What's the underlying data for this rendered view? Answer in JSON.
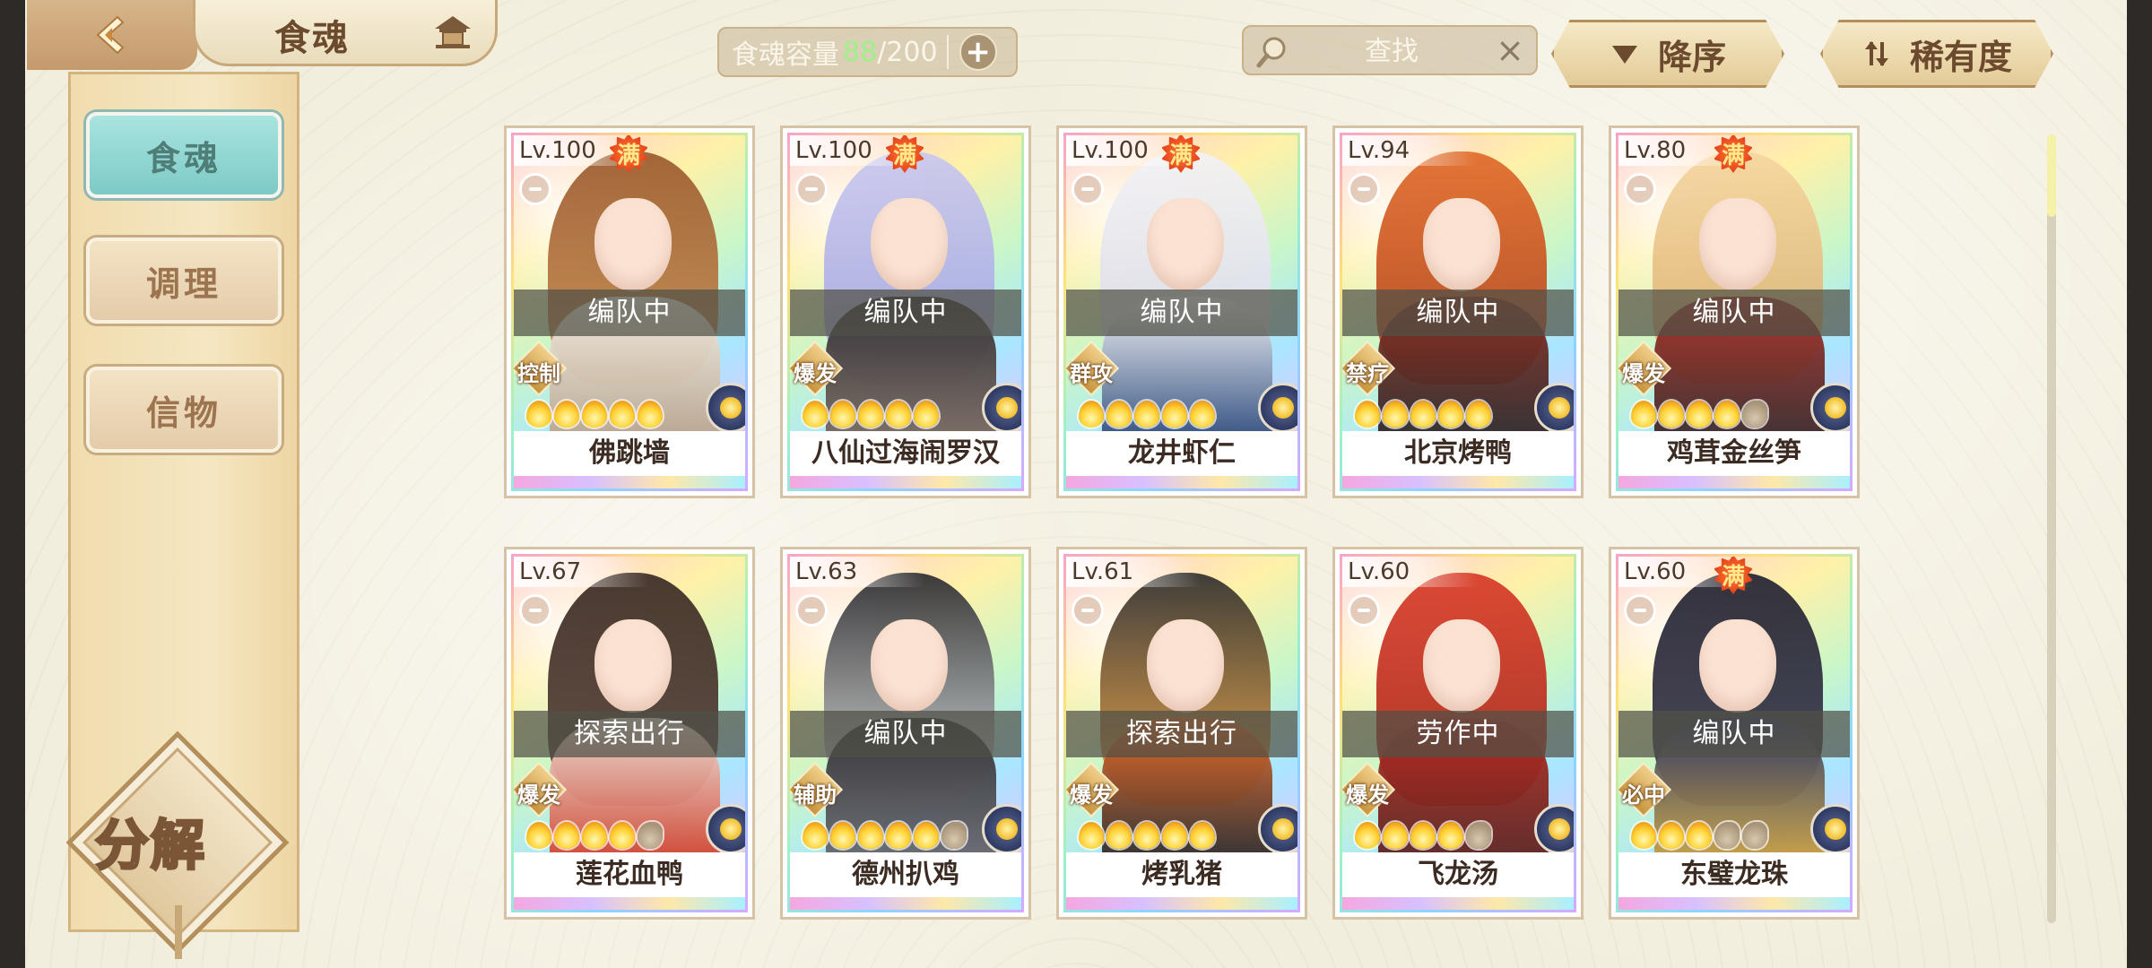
{
  "header": {
    "title": "食魂",
    "capacity": {
      "label": "食魂容量",
      "current": "88",
      "max": "/200",
      "add_label": "+"
    },
    "search": {
      "placeholder": "查找"
    },
    "sort_order_label": "降序",
    "sort_field_label": "稀有度"
  },
  "sidebar": {
    "items": [
      {
        "label": "食魂",
        "active": true
      },
      {
        "label": "调理",
        "active": false
      },
      {
        "label": "信物",
        "active": false
      }
    ],
    "decompose_label": "分解"
  },
  "colors": {
    "capacity_current": "#9ef08a",
    "active_tab": "#7dcac6",
    "status_overlay": "#505046"
  },
  "cards": [
    {
      "level": "Lv.100",
      "maxed": true,
      "maxed_label": "满",
      "status": "编队中",
      "role": "控制",
      "stars_filled": 5,
      "stars_total": 5,
      "name": "佛跳墙"
    },
    {
      "level": "Lv.100",
      "maxed": true,
      "maxed_label": "满",
      "status": "编队中",
      "role": "爆发",
      "stars_filled": 5,
      "stars_total": 5,
      "name": "八仙过海闹罗汉"
    },
    {
      "level": "Lv.100",
      "maxed": true,
      "maxed_label": "满",
      "status": "编队中",
      "role": "群攻",
      "stars_filled": 5,
      "stars_total": 5,
      "name": "龙井虾仁"
    },
    {
      "level": "Lv.94",
      "maxed": false,
      "maxed_label": "",
      "status": "编队中",
      "role": "禁疗",
      "stars_filled": 5,
      "stars_total": 5,
      "name": "北京烤鸭"
    },
    {
      "level": "Lv.80",
      "maxed": true,
      "maxed_label": "满",
      "status": "编队中",
      "role": "爆发",
      "stars_filled": 4,
      "stars_total": 5,
      "name": "鸡茸金丝笋"
    },
    {
      "level": "Lv.67",
      "maxed": false,
      "maxed_label": "",
      "status": "探索出行",
      "role": "爆发",
      "stars_filled": 4,
      "stars_total": 5,
      "name": "莲花血鸭"
    },
    {
      "level": "Lv.63",
      "maxed": false,
      "maxed_label": "",
      "status": "编队中",
      "role": "辅助",
      "stars_filled": 5,
      "stars_total": 6,
      "name": "德州扒鸡"
    },
    {
      "level": "Lv.61",
      "maxed": false,
      "maxed_label": "",
      "status": "探索出行",
      "role": "爆发",
      "stars_filled": 5,
      "stars_total": 5,
      "name": "烤乳猪"
    },
    {
      "level": "Lv.60",
      "maxed": false,
      "maxed_label": "",
      "status": "劳作中",
      "role": "爆发",
      "stars_filled": 4,
      "stars_total": 5,
      "name": "飞龙汤"
    },
    {
      "level": "Lv.60",
      "maxed": true,
      "maxed_label": "满",
      "status": "编队中",
      "role": "必中",
      "stars_filled": 3,
      "stars_total": 5,
      "name": "东璧龙珠"
    }
  ]
}
